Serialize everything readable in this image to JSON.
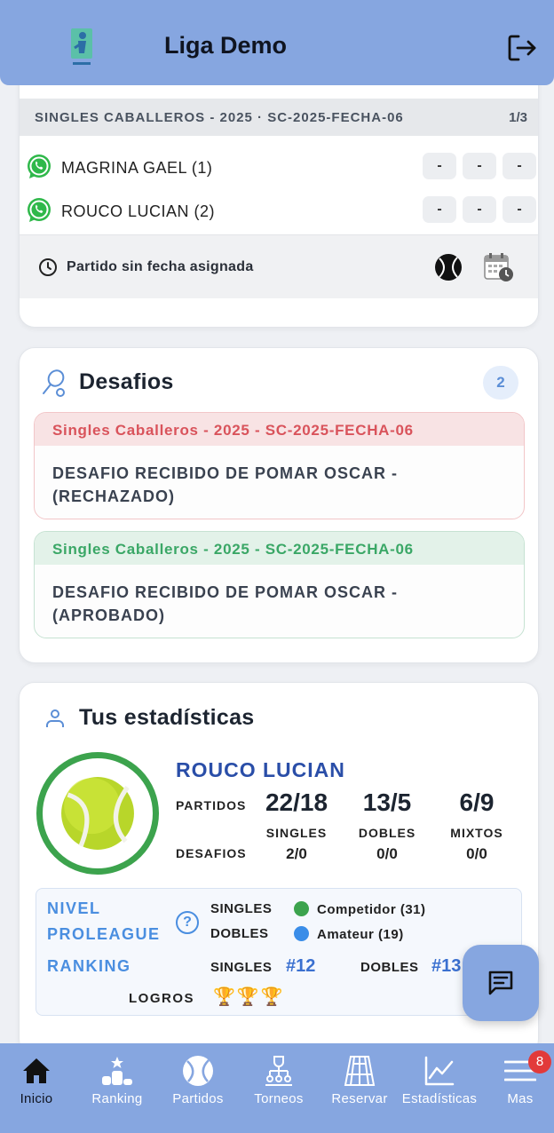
{
  "header": {
    "title": "Liga Demo",
    "logo_icon": "league-logo-icon",
    "logout_icon": "logout-icon"
  },
  "match": {
    "title": "SINGLES CABALLEROS - 2025 · SC-2025-FECHA-06",
    "page": "1/3",
    "players": [
      {
        "name": "MAGRINA GAEL (1)",
        "scores": [
          "-",
          "-",
          "-"
        ]
      },
      {
        "name": "ROUCO LUCIAN (2)",
        "scores": [
          "-",
          "-",
          "-"
        ]
      }
    ],
    "no_date": "Partido sin fecha asignada"
  },
  "desafios": {
    "title": "Desafios",
    "count": "2",
    "items": [
      {
        "header": "Singles Caballeros - 2025 - SC-2025-FECHA-06",
        "body": "DESAFIO RECIBIDO DE POMAR OSCAR - (RECHAZADO)",
        "status_color": "#d9535b"
      },
      {
        "header": "Singles Caballeros - 2025 - SC-2025-FECHA-06",
        "body": "DESAFIO RECIBIDO DE POMAR OSCAR - (APROBADO)",
        "status_color": "#3aa766"
      }
    ]
  },
  "stats": {
    "title": "Tus estadísticas",
    "player": "ROUCO LUCIAN",
    "partidos_label": "PARTIDOS",
    "desafios_label": "DESAFIOS",
    "cols": [
      {
        "big": "22/18",
        "label": "SINGLES",
        "desafios": "2/0"
      },
      {
        "big": "13/5",
        "label": "DOBLES",
        "desafios": "0/0"
      },
      {
        "big": "6/9",
        "label": "MIXTOS",
        "desafios": "0/0"
      }
    ],
    "nivel_label_1": "NIVEL",
    "nivel_label_2": "PROLEAGUE",
    "nivel_singles_label": "SINGLES",
    "nivel_singles_value": "Competidor (31)",
    "nivel_singles_color": "#3ca34d",
    "nivel_dobles_label": "DOBLES",
    "nivel_dobles_value": "Amateur (19)",
    "nivel_dobles_color": "#3a8de8",
    "ranking_label": "RANKING",
    "ranking_singles_label": "SINGLES",
    "ranking_singles_value": "#12",
    "ranking_dobles_label": "DOBLES",
    "ranking_dobles_value": "#13",
    "logros_label": "LOGROS",
    "logros": "🏆🏆🏆"
  },
  "tabs": [
    {
      "label": "Inicio",
      "icon": "home-icon"
    },
    {
      "label": "Ranking",
      "icon": "podium-icon"
    },
    {
      "label": "Partidos",
      "icon": "tennis-ball-icon"
    },
    {
      "label": "Torneos",
      "icon": "tournament-icon"
    },
    {
      "label": "Reservar",
      "icon": "court-icon"
    },
    {
      "label": "Estadísticas",
      "icon": "chart-icon"
    },
    {
      "label": "Mas",
      "icon": "menu-icon"
    }
  ],
  "notifications": "8"
}
